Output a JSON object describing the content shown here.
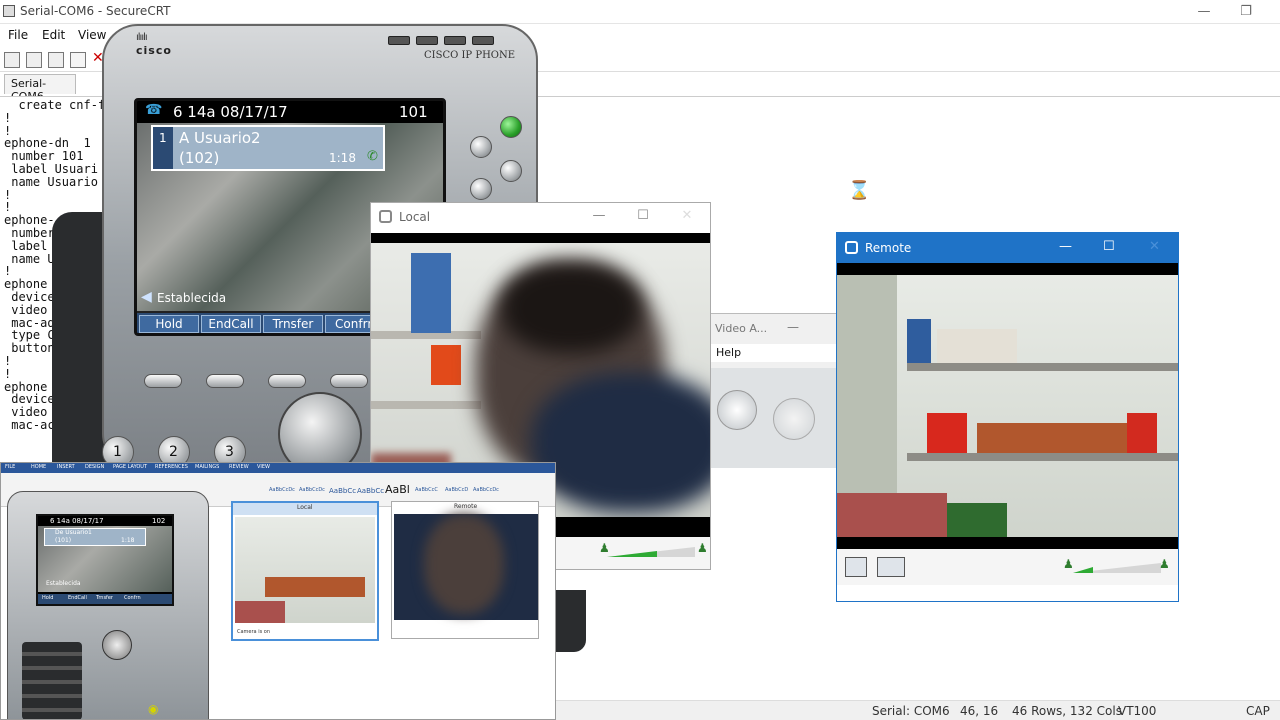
{
  "crt": {
    "title": "Serial-COM6 - SecureCRT",
    "menu": [
      "File",
      "Edit",
      "View"
    ],
    "tab": "Serial-COM6",
    "terminal_lines": [
      "  create cnf-f",
      "!",
      "!",
      "ephone-dn  1",
      " number 101",
      " label Usuari",
      " name Usuario",
      "!",
      "!",
      "ephone-",
      " number",
      " label",
      " name U",
      "!",
      "ephone",
      " device",
      " video",
      " mac-ad",
      " type C",
      " button",
      "!",
      "!",
      "ephone",
      " device",
      " video",
      " mac-ac"
    ],
    "status": {
      "session": "Serial: COM6",
      "cursor": "46, 16",
      "size": "46 Rows, 132 Cols",
      "emulation": "VT100",
      "caps": "CAP"
    }
  },
  "phone": {
    "brand": "cisco",
    "model_label": "CISCO IP PHONE",
    "header_time": "6 14a 08/17/17",
    "header_ext": "101",
    "call_line": "1",
    "call_name": "A Usuario2",
    "call_number": "(102)",
    "call_timer": "1:18",
    "call_state": "Establecida",
    "softkeys": [
      "Hold",
      "EndCall",
      "Trnsfer",
      "Confrn"
    ],
    "keypad": [
      "1",
      "2",
      "3"
    ]
  },
  "local_window": {
    "title": "Local"
  },
  "remote_window": {
    "title": "Remote"
  },
  "video_assistant": {
    "title": "Video A...",
    "menu": "Help"
  },
  "word_thumb": {
    "tabs": [
      "FILE",
      "HOME",
      "INSERT",
      "DESIGN",
      "PAGE LAYOUT",
      "REFERENCES",
      "MAILINGS",
      "REVIEW",
      "VIEW"
    ],
    "styles": [
      "AaBbCcDc",
      "AaBbCcDc",
      "AaBbCc",
      "AaBbCc",
      "AaBl",
      "AaBbCcC",
      "AaBbCcD",
      "AaBbCcDc"
    ],
    "phone_time": "6 14a 08/17/17",
    "phone_ext": "102",
    "phone_call_name": "De Usuario1",
    "phone_call_number": "(101)",
    "phone_timer": "1:18",
    "phone_state": "Establecida",
    "phone_softkeys": [
      "Hold",
      "EndCall",
      "Trnsfer",
      "Confrn"
    ],
    "local_title": "Local",
    "remote_title": "Remote",
    "caption": "Camera is on"
  }
}
